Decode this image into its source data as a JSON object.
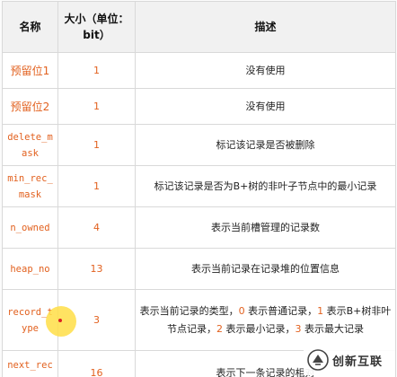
{
  "table": {
    "headers": {
      "name": "名称",
      "size": "大小（单位：bit）",
      "desc": "描述"
    },
    "rows": [
      {
        "name": "预留位1",
        "size": "1",
        "desc": "没有使用"
      },
      {
        "name": "预留位2",
        "size": "1",
        "desc": "没有使用"
      },
      {
        "name": "delete_mask",
        "size": "1",
        "desc": "标记该记录是否被删除"
      },
      {
        "name": "min_rec_mask",
        "size": "1",
        "desc": "标记该记录是否为B+树的非叶子节点中的最小记录"
      },
      {
        "name": "n_owned",
        "size": "4",
        "desc": "表示当前槽管理的记录数"
      },
      {
        "name": "heap_no",
        "size": "13",
        "desc": "表示当前记录在记录堆的位置信息"
      },
      {
        "name": "record_type",
        "size": "3",
        "desc_parts": [
          "表示当前记录的类型，",
          "0",
          " 表示普通记录，",
          "1",
          " 表示B+树非叶节点记录，",
          "2",
          " 表示最小记录，",
          "3",
          " 表示最大记录"
        ]
      },
      {
        "name": "next_record",
        "size": "16",
        "desc": "表示下一条记录的相对"
      }
    ]
  },
  "watermark": {
    "text": "创新互联",
    "logo_icon": "brand-logo-icon"
  },
  "colors": {
    "accent": "#e2611f",
    "header_bg": "#f1f1f1",
    "border": "#d9d9d9",
    "cursor_highlight": "#ffde46"
  }
}
